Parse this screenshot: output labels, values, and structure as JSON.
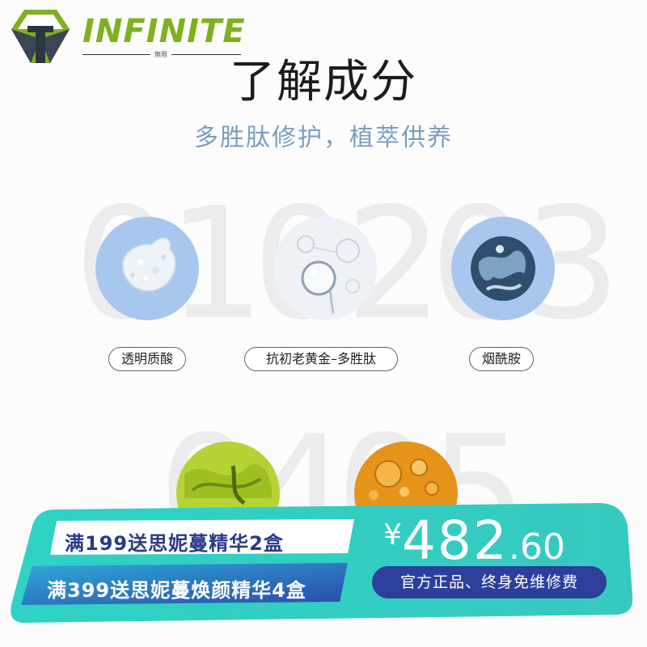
{
  "brand": {
    "name": "INFINITE",
    "sub": "無限"
  },
  "header": {
    "title": "了解成分",
    "subtitle": "多胜肽修护，植萃供养"
  },
  "ingredients": [
    {
      "number": "01",
      "label": "透明质酸"
    },
    {
      "number": "02",
      "label": "抗初老黄金–多胜肽"
    },
    {
      "number": "03",
      "label": "烟酰胺"
    },
    {
      "number": "04",
      "label": ""
    },
    {
      "number": "05",
      "label": ""
    }
  ],
  "promo": {
    "line1": "满199送思妮蔓精华2盒",
    "line2": "满399送思妮蔓焕颜精华4盒",
    "price_symbol": "¥",
    "price_main": "482",
    "price_decimal": ".60",
    "tag": "官方正品、终身免维修费"
  },
  "colors": {
    "brand_green": "#7fb01e",
    "subtitle_blue": "#7b9ec0",
    "promo_teal": "#2fd2c4",
    "promo_navy": "#2c3f9a"
  }
}
